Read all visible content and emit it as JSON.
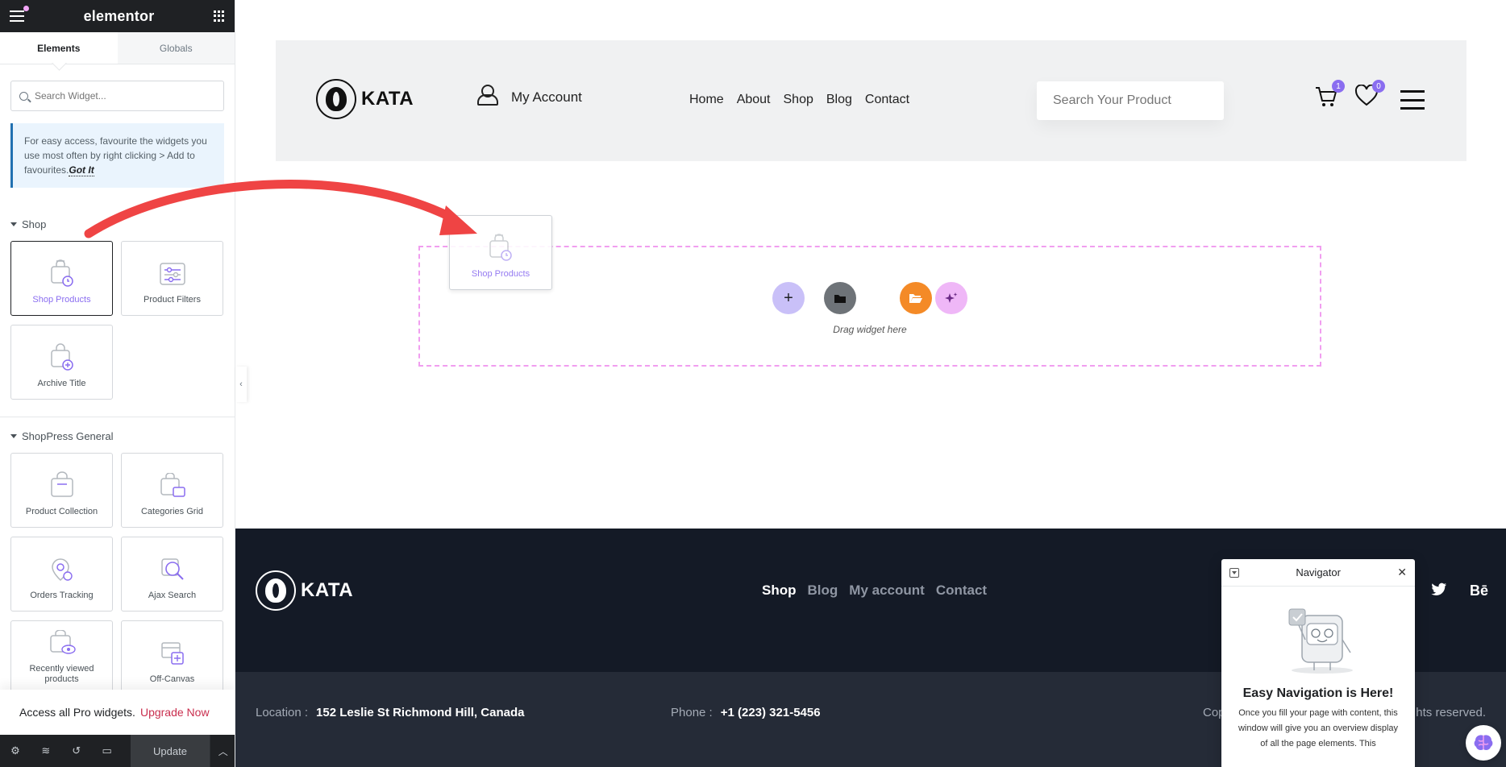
{
  "editor": {
    "logo": "elementor",
    "tabs": [
      "Elements",
      "Globals"
    ],
    "search_placeholder": "Search Widget...",
    "notice_text": "For easy access, favourite the widgets you use most often by right clicking > Add to favourites.",
    "notice_link": "Got It",
    "categories": {
      "shop": {
        "title": "Shop",
        "widgets": [
          "Shop Products",
          "Product Filters",
          "Archive Title"
        ]
      },
      "general": {
        "title": "ShopPress General",
        "widgets": [
          "Product Collection",
          "Categories Grid",
          "Orders Tracking",
          "Ajax Search",
          "Recently viewed products",
          "Off-Canvas"
        ]
      }
    },
    "pro_text": "Access all Pro widgets.",
    "pro_link": "Upgrade Now",
    "update_label": "Update"
  },
  "site": {
    "brand": "KATA",
    "account_label": "My Account",
    "nav": [
      "Home",
      "About",
      "Shop",
      "Blog",
      "Contact"
    ],
    "search_placeholder": "Search Your Product",
    "cart_count": "1",
    "wishlist_count": "0"
  },
  "canvas": {
    "drop_text": "Drag widget here",
    "drag_ghost_label": "Shop Products"
  },
  "footer": {
    "brand": "KATA",
    "nav": [
      "Shop",
      "Blog",
      "My account",
      "Contact"
    ],
    "socials": [
      "twitter-icon",
      "behance-icon"
    ],
    "location_label": "Location :",
    "location_value": "152 Leslie St Richmond Hill, Canada",
    "phone_label": "Phone :",
    "phone_value": "+1 (223) 321-5456",
    "copyright_partial": "Cop",
    "rights_partial": "hts reserved."
  },
  "navigator": {
    "title": "Navigator",
    "heading": "Easy Navigation is Here!",
    "desc": "Once you fill your page with content, this window will give you an overview display of all the page elements. This"
  },
  "colors": {
    "accent": "#8a6df0",
    "panel_dark": "#1f2124",
    "drop_border": "#f19ef0",
    "arrow": "#ef4444",
    "footer_bg": "#141a26"
  }
}
